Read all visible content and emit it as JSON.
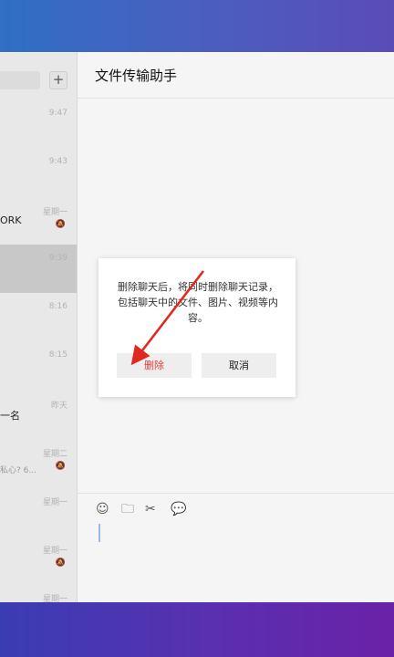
{
  "chat_list": {
    "add_label": "+",
    "rows": [
      {
        "name": "",
        "preview": "",
        "time": "9:47",
        "mute": ""
      },
      {
        "name": "",
        "preview": "",
        "time": "9:43",
        "mute": ""
      },
      {
        "name": "ORK",
        "preview": "",
        "time": "星期一",
        "mute": "🔕"
      },
      {
        "name": "",
        "preview": "",
        "time": "9:39",
        "mute": ""
      },
      {
        "name": "",
        "preview": "",
        "time": "8:16",
        "mute": ""
      },
      {
        "name": "",
        "preview": "",
        "time": "8:15",
        "mute": ""
      },
      {
        "name": "一名",
        "preview": "",
        "time": "昨天",
        "mute": ""
      },
      {
        "name": "",
        "preview": "私心? 6...",
        "time": "星期二",
        "mute": "🔕"
      },
      {
        "name": "",
        "preview": "",
        "time": "星期一",
        "mute": ""
      },
      {
        "name": "",
        "preview": "",
        "time": "星期一",
        "mute": "🔕"
      },
      {
        "name": "",
        "preview": "",
        "time": "星期一",
        "mute": ""
      }
    ]
  },
  "main": {
    "title": "文件传输助手",
    "toolbar": {
      "emoji_icon": "☺",
      "folder_icon": "🗀",
      "scissors_icon": "✂",
      "chat_icon": "💬"
    }
  },
  "dialog": {
    "message": "删除聊天后，将同时删除聊天记录，包括聊天中的文件、图片、视频等内容。",
    "delete_label": "删除",
    "cancel_label": "取消"
  },
  "colors": {
    "top_band": "#4a5fc0",
    "bottom_band": "#5a2fb0",
    "delete_text": "#e0413c",
    "arrow": "#e02a20"
  }
}
